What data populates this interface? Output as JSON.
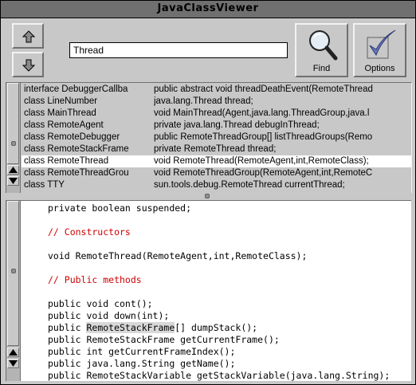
{
  "window": {
    "title": "JavaClassViewer"
  },
  "toolbar": {
    "up_icon": "up-arrow-icon",
    "down_icon": "down-arrow-icon",
    "search_value": "Thread",
    "find_label": "Find",
    "find_icon": "magnifier-icon",
    "options_label": "Options",
    "options_icon": "checkmark-icon"
  },
  "class_list": {
    "selected_index": 6,
    "rows": [
      {
        "cls": "interface DebuggerCallba",
        "member": "public abstract void threadDeathEvent(RemoteThread"
      },
      {
        "cls": "class LineNumber",
        "member": "java.lang.Thread thread;"
      },
      {
        "cls": "class MainThread",
        "member": "void MainThread(Agent,java.lang.ThreadGroup,java.l"
      },
      {
        "cls": "class RemoteAgent",
        "member": "private java.lang.Thread debugInThread;"
      },
      {
        "cls": "class RemoteDebugger",
        "member": "public RemoteThreadGroup[] listThreadGroups(Remo"
      },
      {
        "cls": "class RemoteStackFrame",
        "member": "private RemoteThread thread;"
      },
      {
        "cls": "class RemoteThread",
        "member": "void RemoteThread(RemoteAgent,int,RemoteClass);"
      },
      {
        "cls": "class RemoteThreadGrou",
        "member": "void RemoteThreadGroup(RemoteAgent,int,RemoteC"
      },
      {
        "cls": "class TTY",
        "member": "sun.tools.debug.RemoteThread currentThread;"
      }
    ]
  },
  "source": {
    "highlight": "RemoteStackFrame",
    "lines": [
      {
        "text": "private boolean suspended;",
        "type": "code"
      },
      {
        "text": "",
        "type": "blank"
      },
      {
        "text": "// Constructors",
        "type": "comment"
      },
      {
        "text": "",
        "type": "blank"
      },
      {
        "text": "void RemoteThread(RemoteAgent,int,RemoteClass);",
        "type": "code"
      },
      {
        "text": "",
        "type": "blank"
      },
      {
        "text": "// Public methods",
        "type": "comment"
      },
      {
        "text": "",
        "type": "blank"
      },
      {
        "text": "public void cont();",
        "type": "code"
      },
      {
        "text": "public void down(int);",
        "type": "code"
      },
      {
        "pre": "public ",
        "hl": "RemoteStackFrame",
        "post": "[] dumpStack();",
        "type": "highlight"
      },
      {
        "text": "public RemoteStackFrame getCurrentFrame();",
        "type": "code"
      },
      {
        "text": "public int getCurrentFrameIndex();",
        "type": "code"
      },
      {
        "text": "public java.lang.String getName();",
        "type": "code"
      },
      {
        "text": "public RemoteStackVariable getStackVariable(java.lang.String);",
        "type": "code"
      }
    ]
  }
}
